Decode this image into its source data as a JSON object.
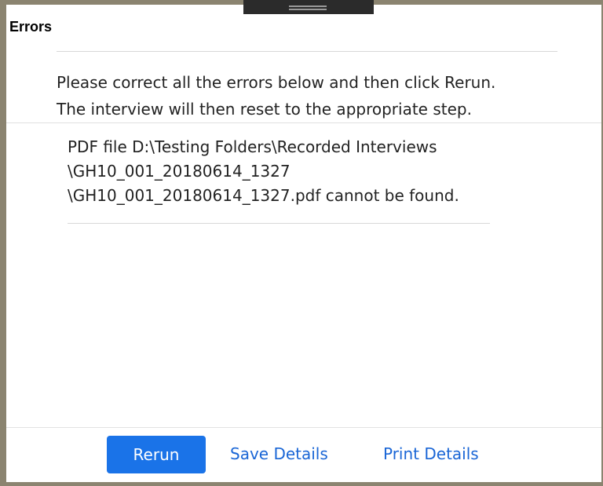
{
  "dialog": {
    "title": "Errors",
    "message_line1": "Please correct all the errors below and then click Rerun.",
    "message_line2": "The interview will then reset to the appropriate step."
  },
  "errors": [
    {
      "line1": "PDF file D:\\Testing Folders\\Recorded Interviews",
      "line2": "\\GH10_001_20180614_1327",
      "line3": "\\GH10_001_20180614_1327.pdf cannot be found."
    }
  ],
  "footer": {
    "rerun_label": "Rerun",
    "save_label": "Save Details",
    "print_label": "Print Details"
  },
  "colors": {
    "primary": "#1a73e8",
    "link": "#1a66d6",
    "frame": "#8b8470"
  },
  "icons": {
    "drag_handle": "drag-handle-icon"
  }
}
